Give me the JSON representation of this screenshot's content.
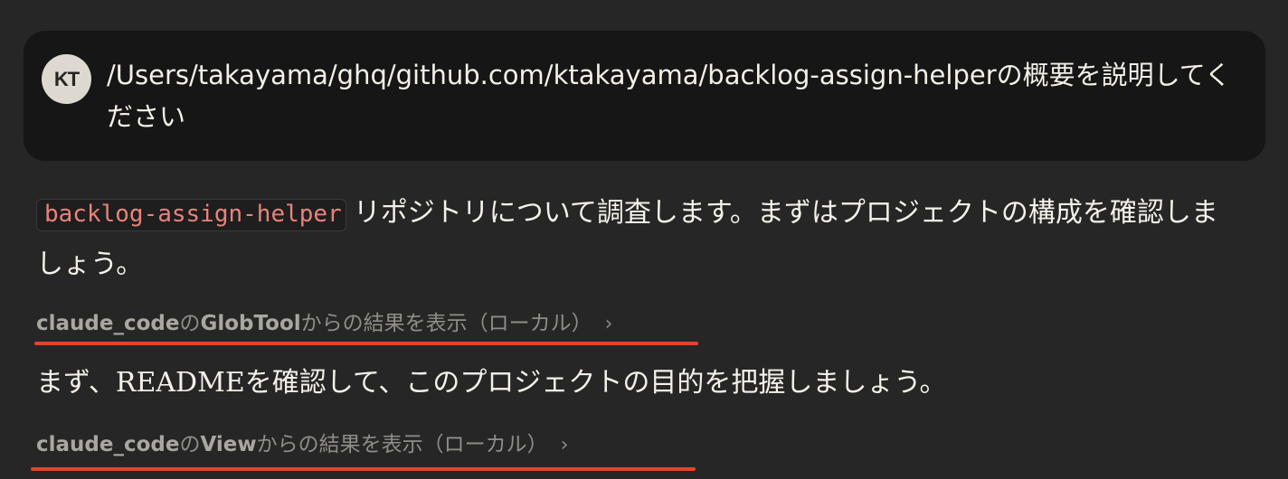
{
  "user_message": {
    "avatar_initials": "KT",
    "text": "/Users/takayama/ghq/github.com/ktakayama/backlog-assign-helperの概要を説明してください"
  },
  "assistant": {
    "para1_code": "backlog-assign-helper",
    "para1_text": "リポジトリについて調査します。まずはプロジェクトの構成を確認しましょう。",
    "tool1": {
      "source": "claude_code",
      "connector": "の",
      "tool": "GlobTool",
      "suffix": "からの結果を表示（ローカル）",
      "chevron": "›"
    },
    "para2_text": "まず、READMEを確認して、このプロジェクトの目的を把握しましょう。",
    "tool2": {
      "source": "claude_code",
      "connector": "の",
      "tool": "View",
      "suffix": "からの結果を表示（ローカル）",
      "chevron": "›"
    }
  },
  "colors": {
    "background": "#262626",
    "user_card": "#161616",
    "inline_code": "#e8837c",
    "annotation_underline": "#e2452b"
  }
}
